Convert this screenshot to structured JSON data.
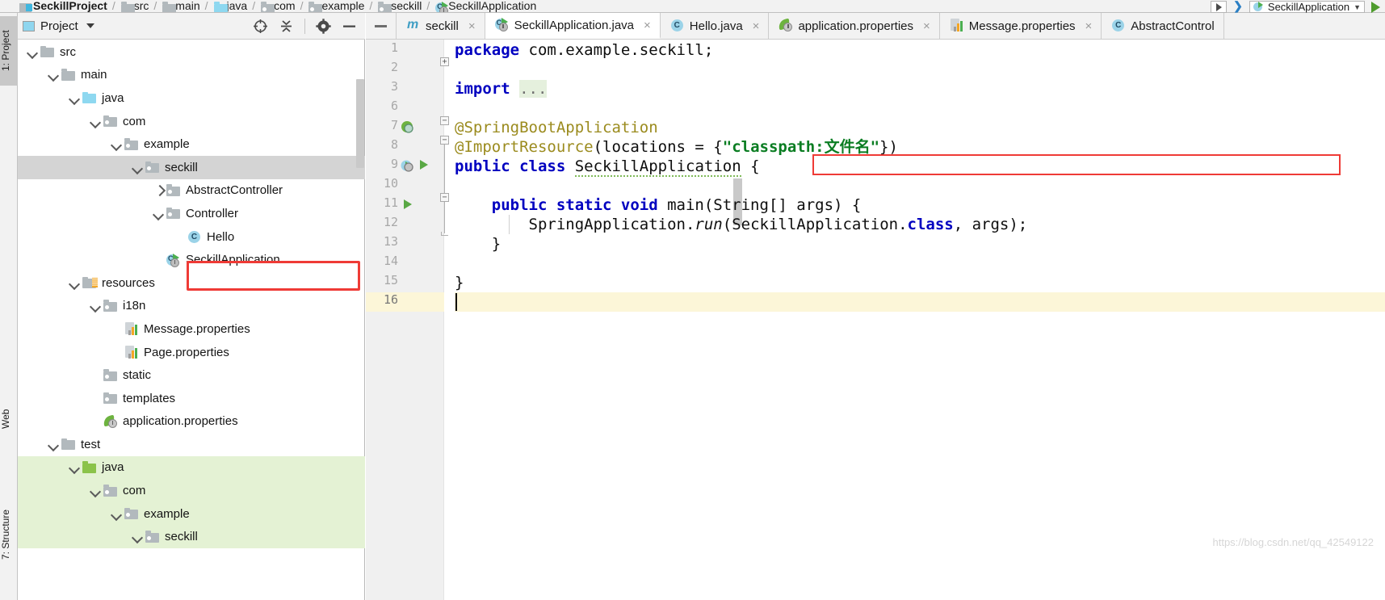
{
  "breadcrumb": [
    {
      "label": "SeckillProject",
      "icon": "module-icon"
    },
    {
      "label": "src",
      "icon": "folder-gray-icon"
    },
    {
      "label": "main",
      "icon": "folder-gray-icon"
    },
    {
      "label": "java",
      "icon": "folder-blue-icon"
    },
    {
      "label": "com",
      "icon": "package-icon"
    },
    {
      "label": "example",
      "icon": "package-icon"
    },
    {
      "label": "seckill",
      "icon": "package-icon"
    },
    {
      "label": "SeckillApplication",
      "icon": "spring-app-icon"
    }
  ],
  "top_right": {
    "run_config": "SeckillApplication",
    "run_button": "run-icon",
    "select_arrow": "chevron-down-icon"
  },
  "tool_strip": {
    "tabs": [
      {
        "label": "1: Project",
        "active": true
      },
      {
        "label": "Web",
        "active": false
      },
      {
        "label": "7: Structure",
        "active": false
      }
    ]
  },
  "project_panel": {
    "title": "Project",
    "title_icon": "project-icon",
    "dropdown_icon": "chevron-down-icon",
    "tools": [
      {
        "name": "locate-icon"
      },
      {
        "name": "collapse-all-icon"
      },
      {
        "name": "gear-icon"
      },
      {
        "name": "hide-icon"
      }
    ],
    "tree": [
      {
        "label": "src",
        "indent": 1,
        "chev": "down",
        "icon": "folder-gray-icon",
        "state": "normal"
      },
      {
        "label": "main",
        "indent": 2,
        "chev": "down",
        "icon": "folder-gray-icon",
        "state": "normal"
      },
      {
        "label": "java",
        "indent": 3,
        "chev": "down",
        "icon": "folder-blue-icon",
        "state": "normal"
      },
      {
        "label": "com",
        "indent": 4,
        "chev": "down",
        "icon": "package-icon",
        "state": "normal"
      },
      {
        "label": "example",
        "indent": 5,
        "chev": "down",
        "icon": "package-icon",
        "state": "normal"
      },
      {
        "label": "seckill",
        "indent": 6,
        "chev": "down",
        "icon": "package-icon",
        "state": "selected"
      },
      {
        "label": "AbstractController",
        "indent": 7,
        "chev": "right",
        "icon": "package-icon",
        "state": "normal"
      },
      {
        "label": "Controller",
        "indent": 7,
        "chev": "down",
        "icon": "package-icon",
        "state": "normal"
      },
      {
        "label": "Hello",
        "indent": 8,
        "chev": "none",
        "icon": "class-icon",
        "state": "normal"
      },
      {
        "label": "SeckillApplication",
        "indent": 7,
        "chev": "none",
        "icon": "spring-app-icon",
        "state": "normal"
      },
      {
        "label": "resources",
        "indent": 3,
        "chev": "down",
        "icon": "resources-icon",
        "state": "normal"
      },
      {
        "label": "i18n",
        "indent": 4,
        "chev": "down",
        "icon": "package-icon",
        "state": "normal"
      },
      {
        "label": "Message.properties",
        "indent": 5,
        "chev": "none",
        "icon": "properties-icon",
        "state": "normal"
      },
      {
        "label": "Page.properties",
        "indent": 5,
        "chev": "none",
        "icon": "properties-icon",
        "state": "normal"
      },
      {
        "label": "static",
        "indent": 4,
        "chev": "none",
        "icon": "package-icon",
        "state": "normal"
      },
      {
        "label": "templates",
        "indent": 4,
        "chev": "none",
        "icon": "package-icon",
        "state": "normal"
      },
      {
        "label": "application.properties",
        "indent": 4,
        "chev": "none",
        "icon": "spring-leaf-icon",
        "state": "normal"
      },
      {
        "label": "test",
        "indent": 2,
        "chev": "down",
        "icon": "folder-gray-icon",
        "state": "normal"
      },
      {
        "label": "java",
        "indent": 3,
        "chev": "down",
        "icon": "folder-green-icon",
        "state": "green"
      },
      {
        "label": "com",
        "indent": 4,
        "chev": "down",
        "icon": "package-icon",
        "state": "green"
      },
      {
        "label": "example",
        "indent": 5,
        "chev": "down",
        "icon": "package-icon",
        "state": "green"
      },
      {
        "label": "seckill",
        "indent": 6,
        "chev": "down",
        "icon": "package-icon",
        "state": "green"
      }
    ],
    "annotation_box_color": "#ef3b36",
    "annotated_item": "SeckillApplication"
  },
  "editor": {
    "collapse_button": "collapse-tabs-icon",
    "tabs": [
      {
        "label": "seckill",
        "icon": "maven-icon",
        "active": false,
        "close": "×"
      },
      {
        "label": "SeckillApplication.java",
        "icon": "spring-app-icon",
        "active": true,
        "close": "×"
      },
      {
        "label": "Hello.java",
        "icon": "class-icon",
        "active": false,
        "close": "×"
      },
      {
        "label": "application.properties",
        "icon": "spring-leaf-icon",
        "active": false,
        "close": "×"
      },
      {
        "label": "Message.properties",
        "icon": "properties-icon",
        "active": false,
        "close": "×"
      },
      {
        "label": "AbstractControl",
        "icon": "class-icon",
        "active": false,
        "close": ""
      }
    ],
    "line_numbers": [
      "1",
      "2",
      "3",
      "6",
      "7",
      "8",
      "9",
      "10",
      "11",
      "12",
      "13",
      "14",
      "15",
      "16"
    ],
    "current_line": "16",
    "code_lines": [
      "package com.example.seckill;",
      "",
      "import ...",
      "",
      "@SpringBootApplication",
      "@ImportResource(locations = {\"classpath:文件名\"})",
      "public class SeckillApplication {",
      "",
      "    public static void main(String[] args) {",
      "        SpringApplication.run(SeckillApplication.class, args);",
      "    }",
      "",
      "}",
      ""
    ],
    "fold_placeholder": "...",
    "annotation_box_color": "#ef3b36",
    "annotated_line": "@ImportResource(locations = {\"classpath:文件名\"})",
    "gutter_markers": [
      {
        "line": "7",
        "name": "spring-bean-gutter-icon"
      },
      {
        "line": "9",
        "name": "run-application-gutter-icon"
      },
      {
        "line": "11",
        "name": "run-method-gutter-icon"
      }
    ]
  },
  "watermark": "https://blog.csdn.net/qq_42549122",
  "colors": {
    "accent_blue": "#8ed8f0",
    "annotation_red": "#ef3b36",
    "test_green": "#e4f2d4",
    "selection_gray": "#d4d4d4",
    "keyword_blue": "#0000c0",
    "string_green": "#0a7d22",
    "annotation_gold": "#9b8b1e",
    "caret_line": "#fcf6d8"
  }
}
